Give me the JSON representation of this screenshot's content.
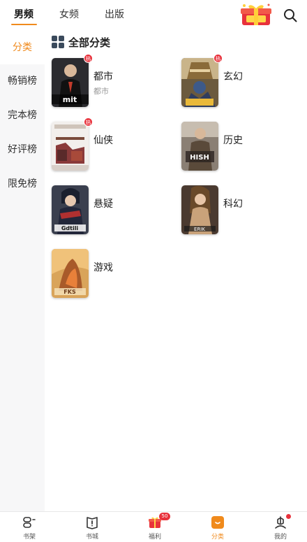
{
  "top_tabs": [
    {
      "label": "男频",
      "active": true
    },
    {
      "label": "女频",
      "active": false
    },
    {
      "label": "出版",
      "active": false
    }
  ],
  "header_icons": {
    "gift": "gift-box-icon",
    "search": "search-icon"
  },
  "sidebar": {
    "items": [
      {
        "label": "分类",
        "active": true
      },
      {
        "label": "畅销榜",
        "active": false
      },
      {
        "label": "完本榜",
        "active": false
      },
      {
        "label": "好评榜",
        "active": false
      },
      {
        "label": "限免榜",
        "active": false
      }
    ]
  },
  "section": {
    "title": "全部分类",
    "icon": "grid-icon"
  },
  "categories": [
    {
      "name": "都市",
      "sub": "都市",
      "hot": true,
      "hot_label": "热"
    },
    {
      "name": "玄幻",
      "sub": "",
      "hot": true,
      "hot_label": "热"
    },
    {
      "name": "仙侠",
      "sub": "",
      "hot": true,
      "hot_label": "热"
    },
    {
      "name": "历史",
      "sub": "",
      "hot": false,
      "hot_label": ""
    },
    {
      "name": "悬疑",
      "sub": "",
      "hot": false,
      "hot_label": ""
    },
    {
      "name": "科幻",
      "sub": "",
      "hot": false,
      "hot_label": ""
    },
    {
      "name": "游戏",
      "sub": "",
      "hot": false,
      "hot_label": ""
    }
  ],
  "bottom_nav": [
    {
      "label": "书架",
      "icon": "bookshelf-icon",
      "active": false
    },
    {
      "label": "书城",
      "icon": "bookstore-icon",
      "active": false
    },
    {
      "label": "福利",
      "icon": "welfare-gift-icon",
      "active": false,
      "badge": "50"
    },
    {
      "label": "分类",
      "icon": "category-icon",
      "active": true
    },
    {
      "label": "我的",
      "icon": "profile-icon",
      "active": false,
      "dot": true
    }
  ],
  "colors": {
    "accent": "#f08a1c",
    "hot_badge": "#e8323c",
    "sidebar_bg": "#f7f7f8"
  }
}
